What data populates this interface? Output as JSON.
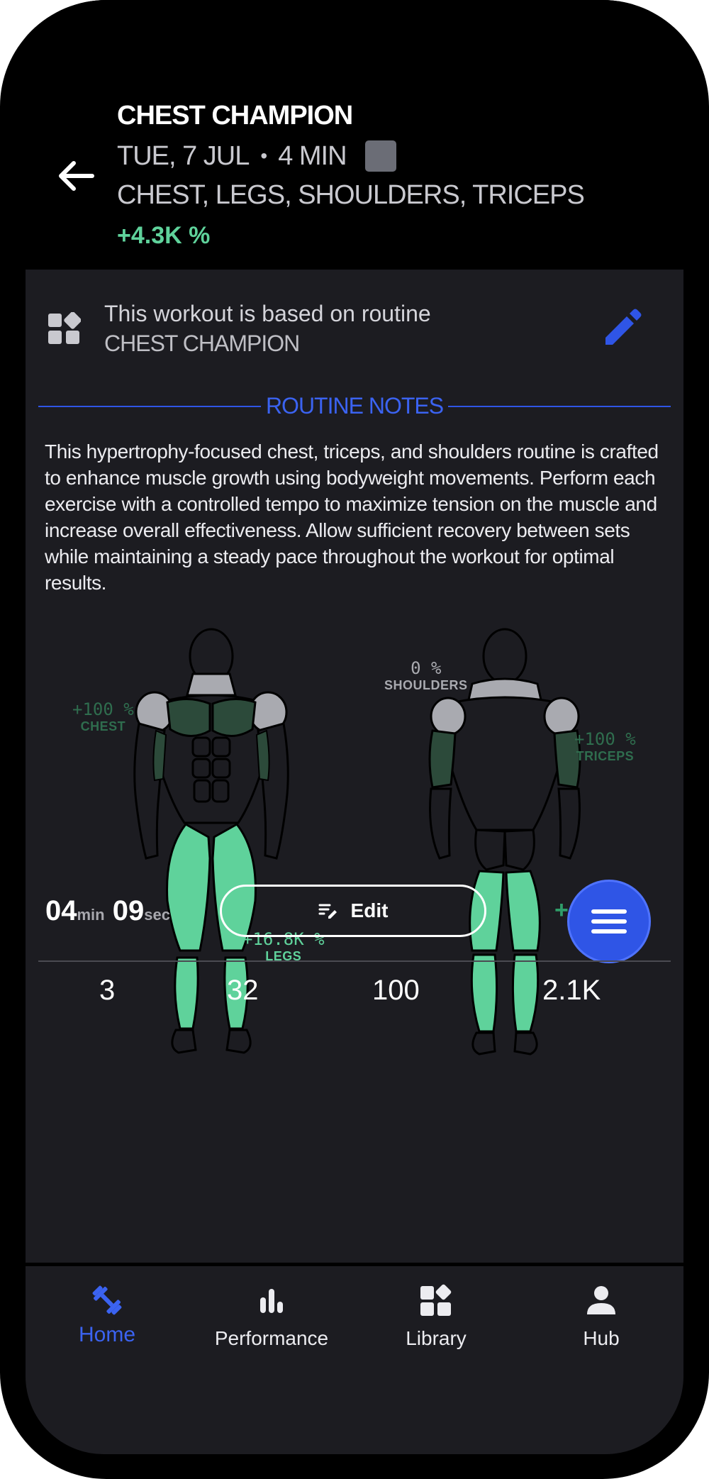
{
  "header": {
    "title": "CHEST CHAMPION",
    "date": "TUE, 7 JUL",
    "duration": "4 MIN",
    "muscles": "CHEST, LEGS, SHOULDERS, TRICEPS",
    "percent": "+4.3K %"
  },
  "routine": {
    "line1": "This workout is based on routine",
    "name": "CHEST CHAMPION"
  },
  "notes": {
    "title": "ROUTINE NOTES",
    "body": "This hypertrophy-focused chest, triceps, and shoulders routine is crafted to enhance muscle growth using bodyweight movements. Perform each exercise with a controlled tempo to maximize tension on the muscle and increase overall effectiveness. Allow sufficient recovery between sets while maintaining a steady pace throughout the workout for optimal results."
  },
  "muscle_labels": {
    "chest": {
      "pct": "+100 %",
      "name": "CHEST"
    },
    "legs": {
      "pct": "+16.8K %",
      "name": "LEGS"
    },
    "shoulders": {
      "pct": "0 %",
      "name": "SHOULDERS"
    },
    "triceps": {
      "pct": "+100 %",
      "name": "TRICEPS"
    }
  },
  "colors": {
    "accent": "#2f55e6",
    "legs_green": "#5fd29b",
    "dark_green": "#2c4a3a",
    "shoulder_grey": "#a9aab0"
  },
  "summary": {
    "minutes": "04",
    "min_unit": "min",
    "seconds": "09",
    "sec_unit": "sec",
    "edit_label": "Edit",
    "right_percent": "+4.3K %",
    "stats": [
      "3",
      "32",
      "100",
      "2.1K"
    ]
  },
  "tabs": [
    {
      "label": "Home",
      "icon": "dumbbell-icon",
      "active": true
    },
    {
      "label": "Performance",
      "icon": "bar-chart-icon",
      "active": false
    },
    {
      "label": "Library",
      "icon": "library-icon",
      "active": false
    },
    {
      "label": "Hub",
      "icon": "person-icon",
      "active": false
    }
  ]
}
